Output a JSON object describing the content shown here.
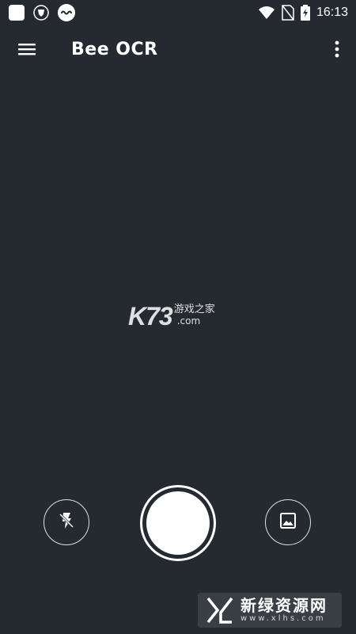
{
  "status_bar": {
    "time": "16:13",
    "icons": [
      "app-square-icon",
      "shield-icon",
      "cloud-link-icon",
      "wifi-icon",
      "no-sim-icon",
      "battery-charging-icon"
    ]
  },
  "app_bar": {
    "title": "Bee OCR",
    "menu_icon": "hamburger-menu-icon",
    "more_icon": "more-vertical-icon"
  },
  "watermark": {
    "logo": "K73",
    "cn": "游戏之家",
    "domain": ".com"
  },
  "controls": {
    "flash_icon": "flash-off-icon",
    "shutter_icon": "shutter-icon",
    "gallery_icon": "gallery-icon"
  },
  "corner_logo": {
    "cn": "新绿资源网",
    "url": "www.xlhs.com"
  },
  "colors": {
    "background": "#252a31",
    "foreground": "#ffffff"
  }
}
